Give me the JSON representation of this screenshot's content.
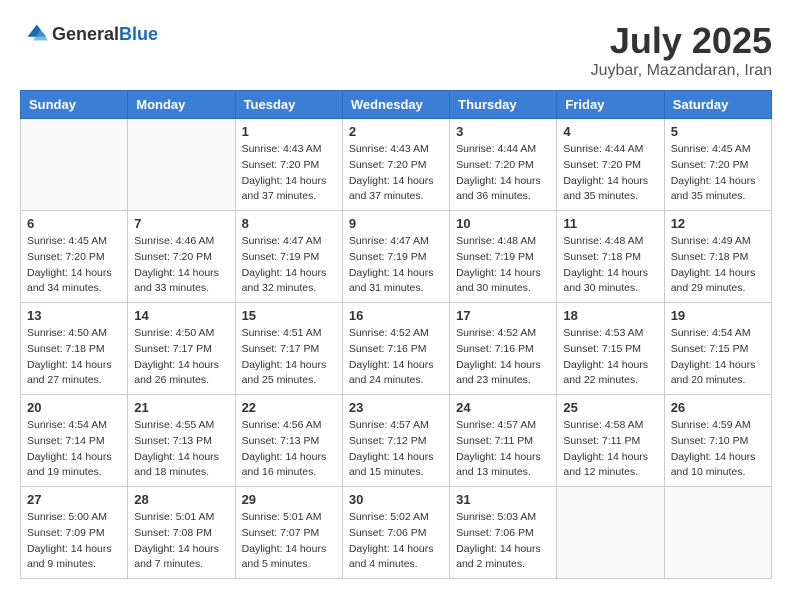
{
  "header": {
    "logo_general": "General",
    "logo_blue": "Blue",
    "month_year": "July 2025",
    "location": "Juybar, Mazandaran, Iran"
  },
  "weekdays": [
    "Sunday",
    "Monday",
    "Tuesday",
    "Wednesday",
    "Thursday",
    "Friday",
    "Saturday"
  ],
  "weeks": [
    [
      {
        "day": "",
        "info": ""
      },
      {
        "day": "",
        "info": ""
      },
      {
        "day": "1",
        "info": "Sunrise: 4:43 AM\nSunset: 7:20 PM\nDaylight: 14 hours and 37 minutes."
      },
      {
        "day": "2",
        "info": "Sunrise: 4:43 AM\nSunset: 7:20 PM\nDaylight: 14 hours and 37 minutes."
      },
      {
        "day": "3",
        "info": "Sunrise: 4:44 AM\nSunset: 7:20 PM\nDaylight: 14 hours and 36 minutes."
      },
      {
        "day": "4",
        "info": "Sunrise: 4:44 AM\nSunset: 7:20 PM\nDaylight: 14 hours and 35 minutes."
      },
      {
        "day": "5",
        "info": "Sunrise: 4:45 AM\nSunset: 7:20 PM\nDaylight: 14 hours and 35 minutes."
      }
    ],
    [
      {
        "day": "6",
        "info": "Sunrise: 4:45 AM\nSunset: 7:20 PM\nDaylight: 14 hours and 34 minutes."
      },
      {
        "day": "7",
        "info": "Sunrise: 4:46 AM\nSunset: 7:20 PM\nDaylight: 14 hours and 33 minutes."
      },
      {
        "day": "8",
        "info": "Sunrise: 4:47 AM\nSunset: 7:19 PM\nDaylight: 14 hours and 32 minutes."
      },
      {
        "day": "9",
        "info": "Sunrise: 4:47 AM\nSunset: 7:19 PM\nDaylight: 14 hours and 31 minutes."
      },
      {
        "day": "10",
        "info": "Sunrise: 4:48 AM\nSunset: 7:19 PM\nDaylight: 14 hours and 30 minutes."
      },
      {
        "day": "11",
        "info": "Sunrise: 4:48 AM\nSunset: 7:18 PM\nDaylight: 14 hours and 30 minutes."
      },
      {
        "day": "12",
        "info": "Sunrise: 4:49 AM\nSunset: 7:18 PM\nDaylight: 14 hours and 29 minutes."
      }
    ],
    [
      {
        "day": "13",
        "info": "Sunrise: 4:50 AM\nSunset: 7:18 PM\nDaylight: 14 hours and 27 minutes."
      },
      {
        "day": "14",
        "info": "Sunrise: 4:50 AM\nSunset: 7:17 PM\nDaylight: 14 hours and 26 minutes."
      },
      {
        "day": "15",
        "info": "Sunrise: 4:51 AM\nSunset: 7:17 PM\nDaylight: 14 hours and 25 minutes."
      },
      {
        "day": "16",
        "info": "Sunrise: 4:52 AM\nSunset: 7:16 PM\nDaylight: 14 hours and 24 minutes."
      },
      {
        "day": "17",
        "info": "Sunrise: 4:52 AM\nSunset: 7:16 PM\nDaylight: 14 hours and 23 minutes."
      },
      {
        "day": "18",
        "info": "Sunrise: 4:53 AM\nSunset: 7:15 PM\nDaylight: 14 hours and 22 minutes."
      },
      {
        "day": "19",
        "info": "Sunrise: 4:54 AM\nSunset: 7:15 PM\nDaylight: 14 hours and 20 minutes."
      }
    ],
    [
      {
        "day": "20",
        "info": "Sunrise: 4:54 AM\nSunset: 7:14 PM\nDaylight: 14 hours and 19 minutes."
      },
      {
        "day": "21",
        "info": "Sunrise: 4:55 AM\nSunset: 7:13 PM\nDaylight: 14 hours and 18 minutes."
      },
      {
        "day": "22",
        "info": "Sunrise: 4:56 AM\nSunset: 7:13 PM\nDaylight: 14 hours and 16 minutes."
      },
      {
        "day": "23",
        "info": "Sunrise: 4:57 AM\nSunset: 7:12 PM\nDaylight: 14 hours and 15 minutes."
      },
      {
        "day": "24",
        "info": "Sunrise: 4:57 AM\nSunset: 7:11 PM\nDaylight: 14 hours and 13 minutes."
      },
      {
        "day": "25",
        "info": "Sunrise: 4:58 AM\nSunset: 7:11 PM\nDaylight: 14 hours and 12 minutes."
      },
      {
        "day": "26",
        "info": "Sunrise: 4:59 AM\nSunset: 7:10 PM\nDaylight: 14 hours and 10 minutes."
      }
    ],
    [
      {
        "day": "27",
        "info": "Sunrise: 5:00 AM\nSunset: 7:09 PM\nDaylight: 14 hours and 9 minutes."
      },
      {
        "day": "28",
        "info": "Sunrise: 5:01 AM\nSunset: 7:08 PM\nDaylight: 14 hours and 7 minutes."
      },
      {
        "day": "29",
        "info": "Sunrise: 5:01 AM\nSunset: 7:07 PM\nDaylight: 14 hours and 5 minutes."
      },
      {
        "day": "30",
        "info": "Sunrise: 5:02 AM\nSunset: 7:06 PM\nDaylight: 14 hours and 4 minutes."
      },
      {
        "day": "31",
        "info": "Sunrise: 5:03 AM\nSunset: 7:06 PM\nDaylight: 14 hours and 2 minutes."
      },
      {
        "day": "",
        "info": ""
      },
      {
        "day": "",
        "info": ""
      }
    ]
  ]
}
